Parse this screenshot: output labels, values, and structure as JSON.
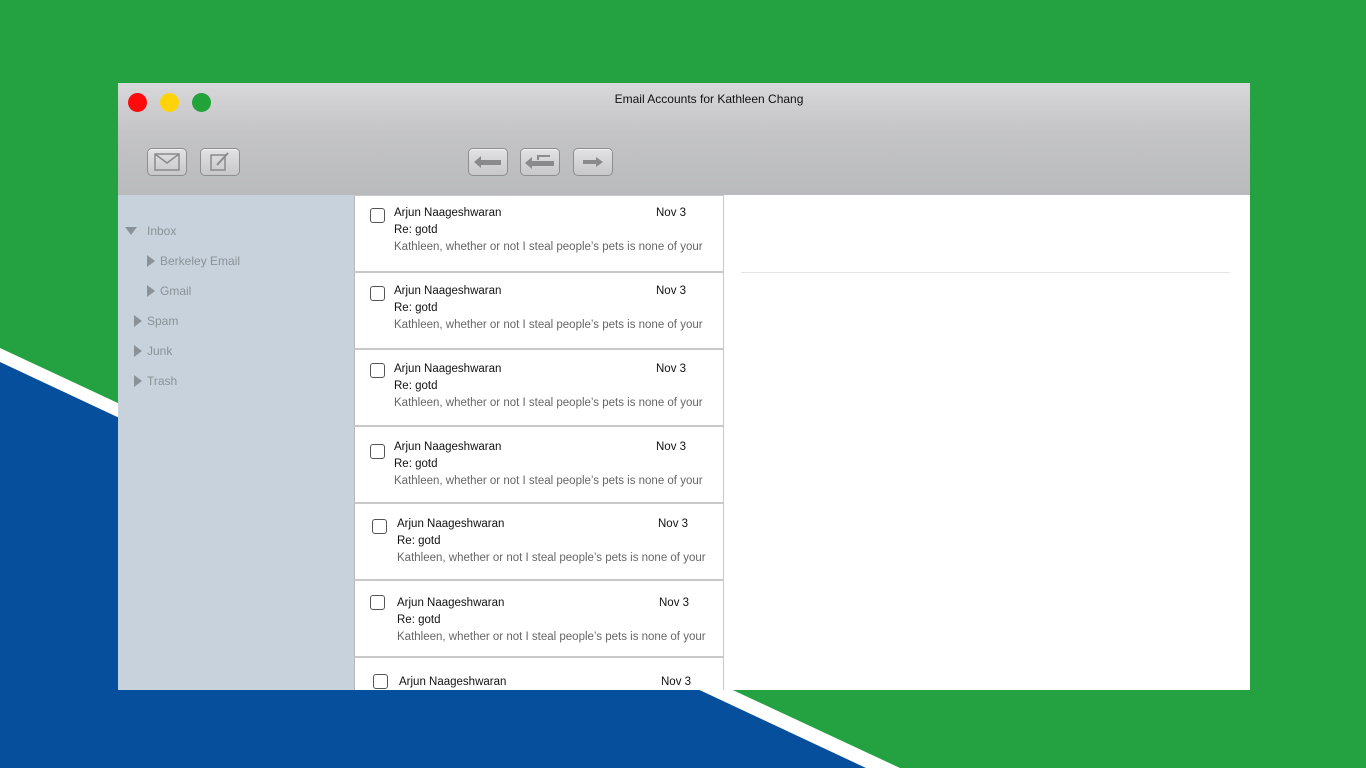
{
  "window": {
    "title": "Email Accounts for Kathleen Chang"
  },
  "toolbar": {
    "buttons": [
      {
        "name": "get-mail",
        "icon": "envelope-icon"
      },
      {
        "name": "compose",
        "icon": "compose-icon"
      },
      {
        "name": "reply",
        "icon": "reply-arrow-icon"
      },
      {
        "name": "reply-all",
        "icon": "reply-all-arrow-icon"
      },
      {
        "name": "forward",
        "icon": "forward-arrow-icon"
      }
    ]
  },
  "sidebar": {
    "items": [
      {
        "label": "Inbox",
        "expanded": true
      },
      {
        "label": "Berkeley Email",
        "expanded": false
      },
      {
        "label": "Gmail",
        "expanded": false
      },
      {
        "label": "Spam",
        "expanded": false
      },
      {
        "label": "Junk",
        "expanded": false
      },
      {
        "label": "Trash",
        "expanded": false
      }
    ]
  },
  "messages": [
    {
      "sender": "Arjun Naageshwaran",
      "date": "Nov 3",
      "subject": "Re: gotd",
      "preview": "Kathleen, whether or not I steal people’s pets is none of your"
    },
    {
      "sender": "Arjun Naageshwaran",
      "date": "Nov 3",
      "subject": "Re: gotd",
      "preview": "Kathleen, whether or not I steal people’s pets is none of your"
    },
    {
      "sender": "Arjun Naageshwaran",
      "date": "Nov 3",
      "subject": "Re: gotd",
      "preview": "Kathleen, whether or not I steal people’s pets is none of your"
    },
    {
      "sender": "Arjun Naageshwaran",
      "date": "Nov 3",
      "subject": "Re: gotd",
      "preview": "Kathleen, whether or not I steal people’s pets is none of your"
    },
    {
      "sender": "Arjun Naageshwaran",
      "date": "Nov 3",
      "subject": "Re: gotd",
      "preview": "Kathleen, whether or not I steal people’s pets is none of your"
    },
    {
      "sender": "Arjun Naageshwaran",
      "date": "Nov 3",
      "subject": "Re: gotd",
      "preview": "Kathleen, whether or not I steal people’s pets is none of your"
    },
    {
      "sender": "Arjun Naageshwaran",
      "date": "Nov 3",
      "subject": "",
      "preview": ""
    }
  ],
  "colors": {
    "background_green": "#24a140",
    "background_blue": "#064f9c",
    "sidebar": "#c8d2dc",
    "close": "#ff0a0a",
    "minimize": "#ffd20a",
    "maximize": "#22a33a"
  }
}
